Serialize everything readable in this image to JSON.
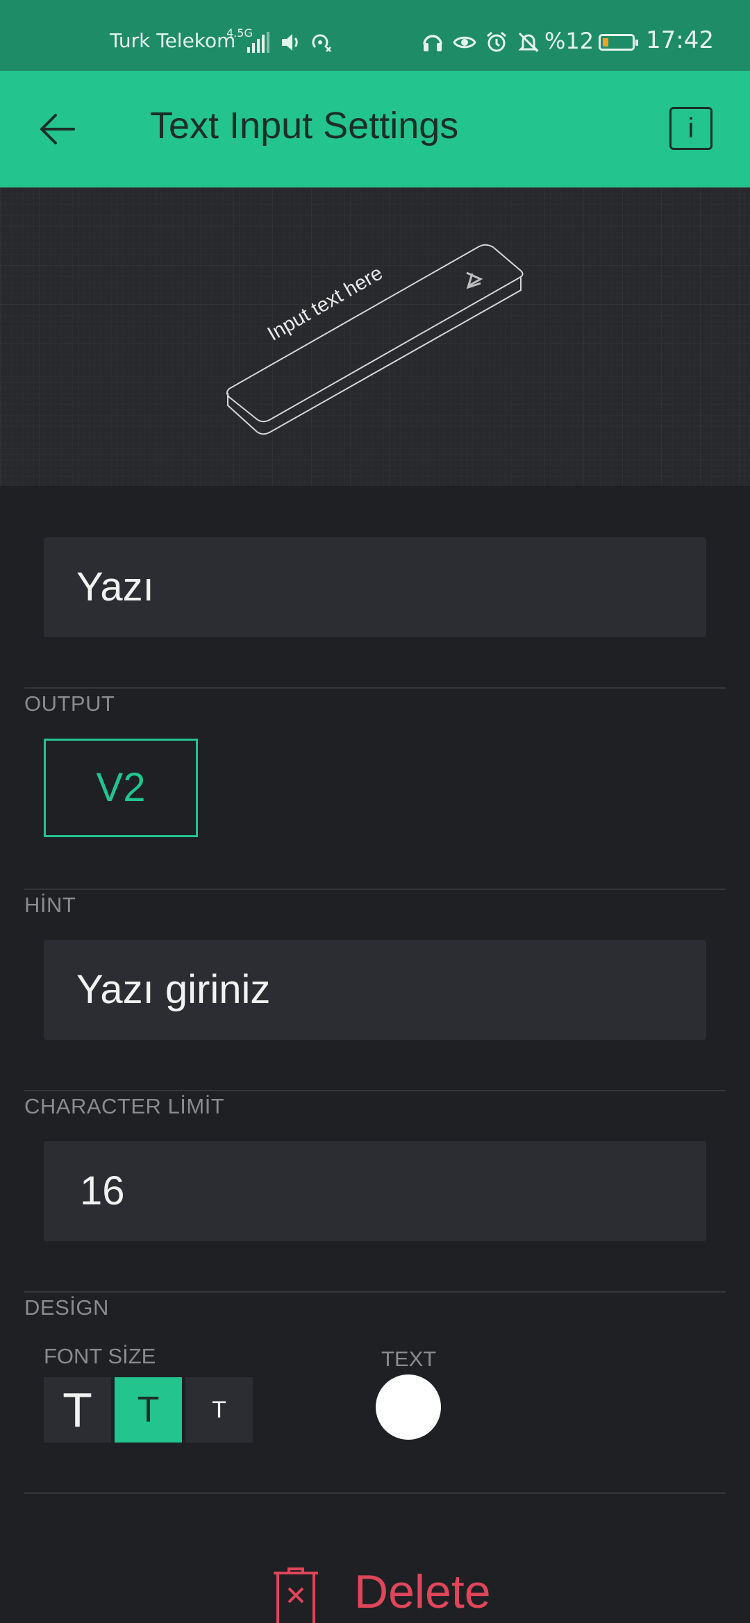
{
  "status_bar": {
    "carrier": "Turk Telekom",
    "network": "4.5G",
    "battery_percent": "%12",
    "battery_level": 0.12,
    "battery_color": "#f4a024",
    "time": "17:42",
    "icons": [
      "signal-icon",
      "volume-icon",
      "hotspot-icon",
      "headset-icon",
      "eye-icon",
      "alarm-icon",
      "notifications-off-icon",
      "battery-icon"
    ]
  },
  "app_bar": {
    "title": "Text Input Settings",
    "back_icon": "back-arrow-icon",
    "info_label": "i",
    "background": "#23c48e"
  },
  "preview": {
    "widget_placeholder": "Input text here"
  },
  "form": {
    "name_value": "Yazı",
    "output": {
      "label": "OUTPUT",
      "pin": "V2",
      "accent": "#23c48e"
    },
    "hint": {
      "label": "HİNT",
      "value": "Yazı giriniz"
    },
    "character_limit": {
      "label": "CHARACTER LİMİT",
      "value": "16"
    },
    "design": {
      "label": "DESİGN",
      "font_size": {
        "label": "FONT SİZE",
        "options": [
          "T",
          "T",
          "T"
        ],
        "selected_index": 1
      },
      "text_color": {
        "label": "TEXT",
        "value": "#ffffff"
      }
    }
  },
  "delete": {
    "label": "Delete",
    "color": "#e0465a"
  }
}
